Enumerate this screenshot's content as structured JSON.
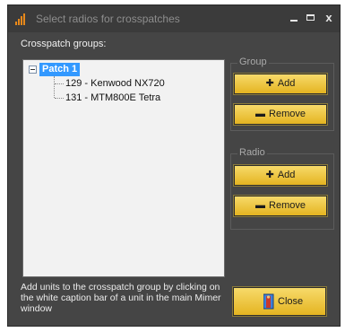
{
  "window": {
    "title": "Select radios for crosspatches",
    "minimize_label": "_",
    "maximize_label": "□",
    "close_label": "x"
  },
  "groups_label": "Crosspatch groups:",
  "tree": {
    "root": "Patch 1",
    "children": [
      "129 - Kenwood NX720",
      "131 - MTM800E Tetra"
    ]
  },
  "group_box": {
    "title": "Group",
    "add_label": "Add",
    "remove_label": "Remove"
  },
  "radio_box": {
    "title": "Radio",
    "add_label": "Add",
    "remove_label": "Remove"
  },
  "hint": "Add units to the crosspatch group by clicking on the white caption bar of a unit in the main Mimer window",
  "close_button_label": "Close",
  "icons": {
    "app": "bar-chart-icon",
    "add": "plus-icon",
    "remove": "minus-icon",
    "close": "door-person-icon"
  },
  "colors": {
    "window_bg": "#454545",
    "button_gold": "#f0c842",
    "selection": "#3399ff"
  }
}
